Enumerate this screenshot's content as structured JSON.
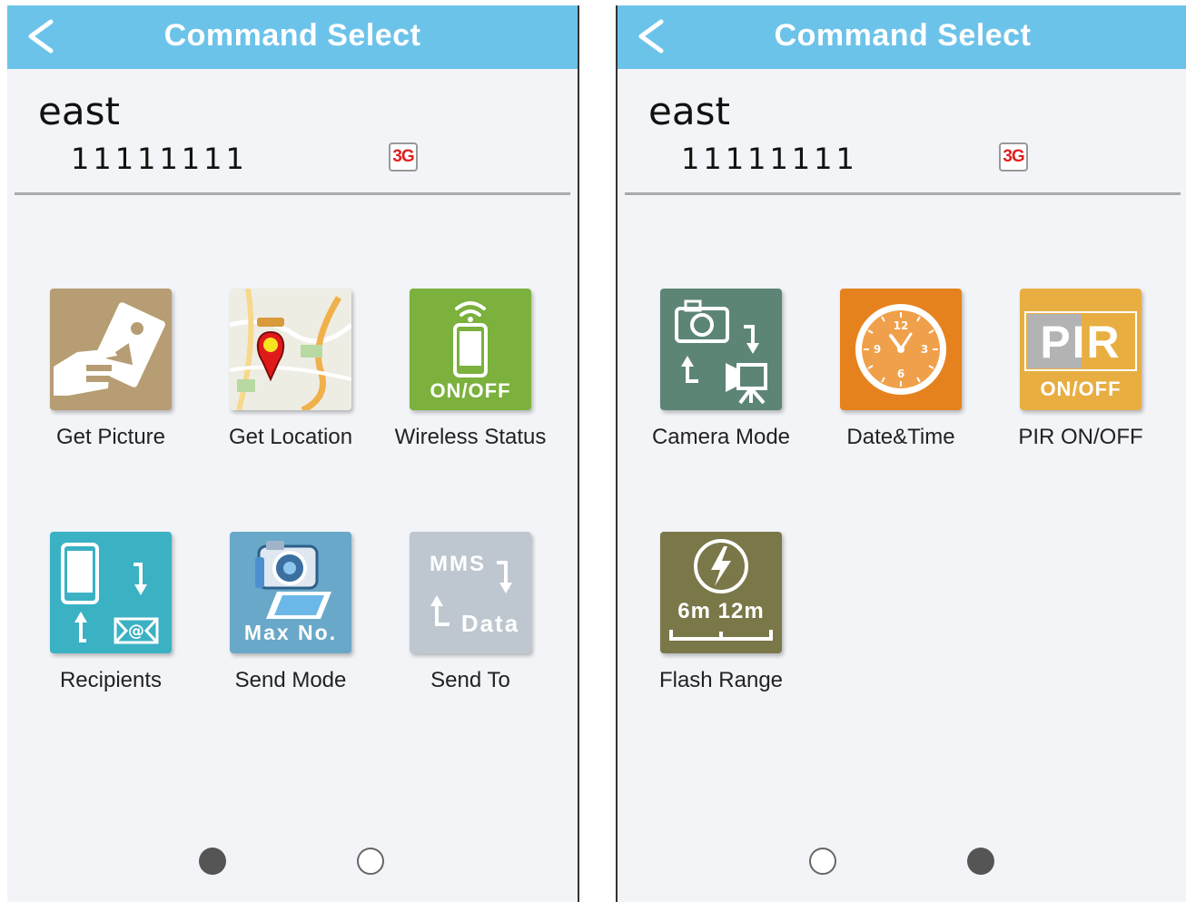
{
  "colors": {
    "topbar": "#6cc3ea",
    "background": "#f2f4f7",
    "badge_text": "#e02020",
    "get_picture": "#b69d73",
    "wireless": "#7bb13c",
    "recipients": "#3bb1c4",
    "send_mode": "#69a8c8",
    "send_to": "#bec7d0",
    "camera_mode": "#5c8575",
    "date_time": "#e6821e",
    "pir": "#e8ae42",
    "flash": "#7a7749"
  },
  "screens": [
    {
      "title": "Command Select",
      "device_name": "east",
      "device_number": "11111111",
      "network_badge": "3G",
      "commands": [
        {
          "label": "Get Picture",
          "icon": "get-picture-icon"
        },
        {
          "label": "Get Location",
          "icon": "get-location-icon"
        },
        {
          "label": "Wireless Status",
          "icon": "wireless-status-icon",
          "icon_text": "ON/OFF"
        },
        {
          "label": "Recipients",
          "icon": "recipients-icon"
        },
        {
          "label": "Send Mode",
          "icon": "send-mode-icon",
          "icon_text": "Max No."
        },
        {
          "label": "Send To",
          "icon": "send-to-icon",
          "icon_text_top": "MMS",
          "icon_text_bottom": "Data"
        }
      ],
      "page_indicator": {
        "current": 1,
        "total": 2
      }
    },
    {
      "title": "Command Select",
      "device_name": "east",
      "device_number": "11111111",
      "network_badge": "3G",
      "commands": [
        {
          "label": "Camera Mode",
          "icon": "camera-mode-icon"
        },
        {
          "label": "Date&Time",
          "icon": "date-time-icon",
          "clock_numbers": [
            "12",
            "3",
            "6",
            "9"
          ]
        },
        {
          "label": "PIR ON/OFF",
          "icon": "pir-icon",
          "icon_text_top": "PIR",
          "icon_text_bottom": "ON/OFF"
        },
        {
          "label": "Flash Range",
          "icon": "flash-range-icon",
          "icon_text": "6m 12m"
        }
      ],
      "page_indicator": {
        "current": 2,
        "total": 2
      }
    }
  ]
}
